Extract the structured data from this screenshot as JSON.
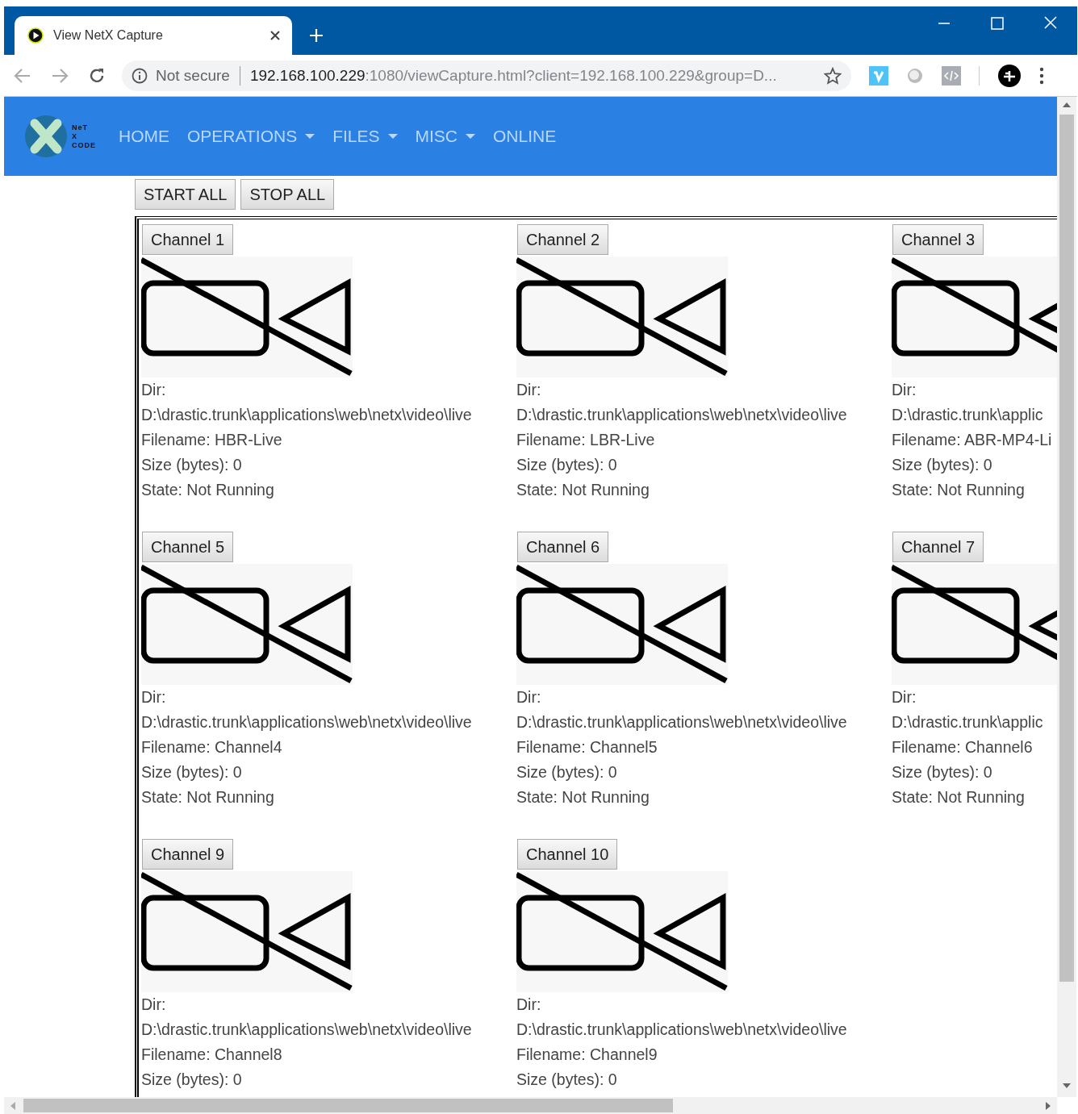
{
  "browser": {
    "tab_title": "View NetX Capture",
    "security": "Not secure",
    "url_host": "192.168.100.229",
    "url_rest": ":1080/viewCapture.html?client=192.168.100.229&group=D..."
  },
  "nav": {
    "logo_text": [
      "NeT",
      "X",
      "CODE"
    ],
    "items": [
      {
        "label": "HOME",
        "dropdown": false
      },
      {
        "label": "OPERATIONS",
        "dropdown": true
      },
      {
        "label": "FILES",
        "dropdown": true
      },
      {
        "label": "MISC",
        "dropdown": true
      },
      {
        "label": "ONLINE",
        "dropdown": false
      }
    ]
  },
  "actions": [
    "START ALL",
    "STOP ALL"
  ],
  "channels": [
    {
      "button": "Channel 1",
      "dir_label": "Dir:",
      "dir": "D:\\drastic.trunk\\applications\\web\\netx\\video\\live",
      "filename": "Filename: HBR-Live",
      "size": "Size (bytes): 0",
      "state": "State: Not Running"
    },
    {
      "button": "Channel 2",
      "dir_label": "Dir:",
      "dir": "D:\\drastic.trunk\\applications\\web\\netx\\video\\live",
      "filename": "Filename: LBR-Live",
      "size": "Size (bytes): 0",
      "state": "State: Not Running"
    },
    {
      "button": "Channel 3",
      "dir_label": "Dir:",
      "dir": "D:\\drastic.trunk\\applic",
      "filename": "Filename: ABR-MP4-Li",
      "size": "Size (bytes): 0",
      "state": "State: Not Running"
    },
    {
      "button": "Channel 5",
      "dir_label": "Dir:",
      "dir": "D:\\drastic.trunk\\applications\\web\\netx\\video\\live",
      "filename": "Filename: Channel4",
      "size": "Size (bytes): 0",
      "state": "State: Not Running"
    },
    {
      "button": "Channel 6",
      "dir_label": "Dir:",
      "dir": "D:\\drastic.trunk\\applications\\web\\netx\\video\\live",
      "filename": "Filename: Channel5",
      "size": "Size (bytes): 0",
      "state": "State: Not Running"
    },
    {
      "button": "Channel 7",
      "dir_label": "Dir:",
      "dir": "D:\\drastic.trunk\\applic",
      "filename": "Filename: Channel6",
      "size": "Size (bytes): 0",
      "state": "State: Not Running"
    },
    {
      "button": "Channel 9",
      "dir_label": "Dir:",
      "dir": "D:\\drastic.trunk\\applications\\web\\netx\\video\\live",
      "filename": "Filename: Channel8",
      "size": "Size (bytes): 0"
    },
    {
      "button": "Channel 10",
      "dir_label": "Dir:",
      "dir": "D:\\drastic.trunk\\applications\\web\\netx\\video\\live",
      "filename": "Filename: Channel9",
      "size": "Size (bytes): 0"
    }
  ]
}
